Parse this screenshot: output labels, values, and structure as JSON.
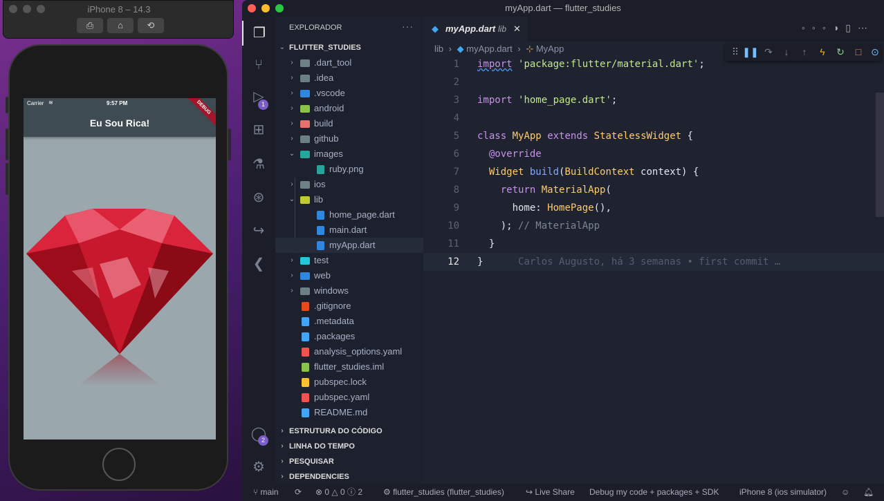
{
  "simulator": {
    "title": "iPhone 8 – 14.3",
    "buttons": [
      "screenshot",
      "home",
      "rotate"
    ],
    "status": {
      "carrier": "Carrier",
      "time": "9:57 PM"
    },
    "app_title": "Eu Sou Rica!",
    "debug_banner": "DEBUG"
  },
  "window": {
    "title": "myApp.dart — flutter_studies"
  },
  "explorer": {
    "title": "EXPLORADOR",
    "root": "FLUTTER_STUDIES",
    "items": [
      {
        "name": ".dart_tool",
        "type": "folder",
        "color": "#6d8086",
        "depth": 1
      },
      {
        "name": ".idea",
        "type": "folder",
        "color": "#6d8086",
        "depth": 1
      },
      {
        "name": ".vscode",
        "type": "folder",
        "color": "#2f87e0",
        "depth": 1
      },
      {
        "name": "android",
        "type": "folder",
        "color": "#8bc34a",
        "depth": 1
      },
      {
        "name": "build",
        "type": "folder",
        "color": "#e5736b",
        "depth": 1
      },
      {
        "name": "github",
        "type": "folder",
        "color": "#6d8086",
        "depth": 1
      },
      {
        "name": "images",
        "type": "folder-open",
        "color": "#26a69a",
        "depth": 1
      },
      {
        "name": "ruby.png",
        "type": "file",
        "color": "#26a69a",
        "depth": 2
      },
      {
        "name": "ios",
        "type": "folder",
        "color": "#6d8086",
        "depth": 1
      },
      {
        "name": "lib",
        "type": "folder-open",
        "color": "#c0ca33",
        "depth": 1
      },
      {
        "name": "home_page.dart",
        "type": "file",
        "color": "#2f87e0",
        "depth": 2
      },
      {
        "name": "main.dart",
        "type": "file",
        "color": "#2f87e0",
        "depth": 2
      },
      {
        "name": "myApp.dart",
        "type": "file",
        "color": "#2f87e0",
        "depth": 2,
        "selected": true
      },
      {
        "name": "test",
        "type": "folder",
        "color": "#26c6da",
        "depth": 1
      },
      {
        "name": "web",
        "type": "folder",
        "color": "#2f87e0",
        "depth": 1
      },
      {
        "name": "windows",
        "type": "folder",
        "color": "#6d8086",
        "depth": 1
      },
      {
        "name": ".gitignore",
        "type": "file",
        "color": "#e64a19",
        "depth": 1
      },
      {
        "name": ".metadata",
        "type": "file",
        "color": "#42a5f5",
        "depth": 1
      },
      {
        "name": ".packages",
        "type": "file",
        "color": "#42a5f5",
        "depth": 1
      },
      {
        "name": "analysis_options.yaml",
        "type": "file",
        "color": "#ef5350",
        "depth": 1
      },
      {
        "name": "flutter_studies.iml",
        "type": "file",
        "color": "#8bc34a",
        "depth": 1
      },
      {
        "name": "pubspec.lock",
        "type": "file",
        "color": "#fbc02d",
        "depth": 1
      },
      {
        "name": "pubspec.yaml",
        "type": "file",
        "color": "#ef5350",
        "depth": 1
      },
      {
        "name": "README.md",
        "type": "file",
        "color": "#42a5f5",
        "depth": 1
      }
    ],
    "sections": [
      "ESTRUTURA DO CÓDIGO",
      "LINHA DO TEMPO",
      "PESQUISAR",
      "DEPENDENCIES"
    ]
  },
  "activity": {
    "badges": {
      "debug": "1",
      "accounts": "2"
    }
  },
  "editor": {
    "tab": {
      "name": "myApp.dart",
      "hint": "lib"
    },
    "breadcrumb": [
      "lib",
      "myApp.dart",
      "MyApp"
    ],
    "current_line": 12,
    "blame": "Carlos Augusto, há 3 semanas • first commit …",
    "lines": [
      [
        [
          "kw",
          "import"
        ],
        [
          "id",
          " "
        ],
        [
          "str",
          "'package:flutter/material.dart'"
        ],
        [
          "id",
          ";"
        ]
      ],
      [],
      [
        [
          "kw",
          "import"
        ],
        [
          "id",
          " "
        ],
        [
          "str",
          "'home_page.dart'"
        ],
        [
          "id",
          ";"
        ]
      ],
      [],
      [
        [
          "kw",
          "class"
        ],
        [
          "id",
          " "
        ],
        [
          "cls",
          "MyApp"
        ],
        [
          "id",
          " "
        ],
        [
          "kw",
          "extends"
        ],
        [
          "id",
          " "
        ],
        [
          "cls",
          "StatelessWidget"
        ],
        [
          "id",
          " {"
        ]
      ],
      [
        [
          "id",
          "  "
        ],
        [
          "an",
          "@override"
        ]
      ],
      [
        [
          "id",
          "  "
        ],
        [
          "cls",
          "Widget"
        ],
        [
          "id",
          " "
        ],
        [
          "fn",
          "build"
        ],
        [
          "id",
          "("
        ],
        [
          "cls",
          "BuildContext"
        ],
        [
          "id",
          " context) {"
        ]
      ],
      [
        [
          "id",
          "    "
        ],
        [
          "kw",
          "return"
        ],
        [
          "id",
          " "
        ],
        [
          "cls",
          "MaterialApp"
        ],
        [
          "id",
          "("
        ]
      ],
      [
        [
          "id",
          "      home: "
        ],
        [
          "cls",
          "HomePage"
        ],
        [
          "id",
          "(),"
        ]
      ],
      [
        [
          "id",
          "    ); "
        ],
        [
          "cm",
          "// MaterialApp"
        ]
      ],
      [
        [
          "id",
          "  }"
        ]
      ],
      [
        [
          "id",
          "}"
        ]
      ]
    ]
  },
  "statusbar": {
    "branch": "main",
    "errors": "0",
    "warnings": "0",
    "info": "2",
    "project": "flutter_studies (flutter_studies)",
    "live_share": "Live Share",
    "debug_mode": "Debug my code + packages + SDK",
    "device": "iPhone 8 (ios simulator)"
  }
}
